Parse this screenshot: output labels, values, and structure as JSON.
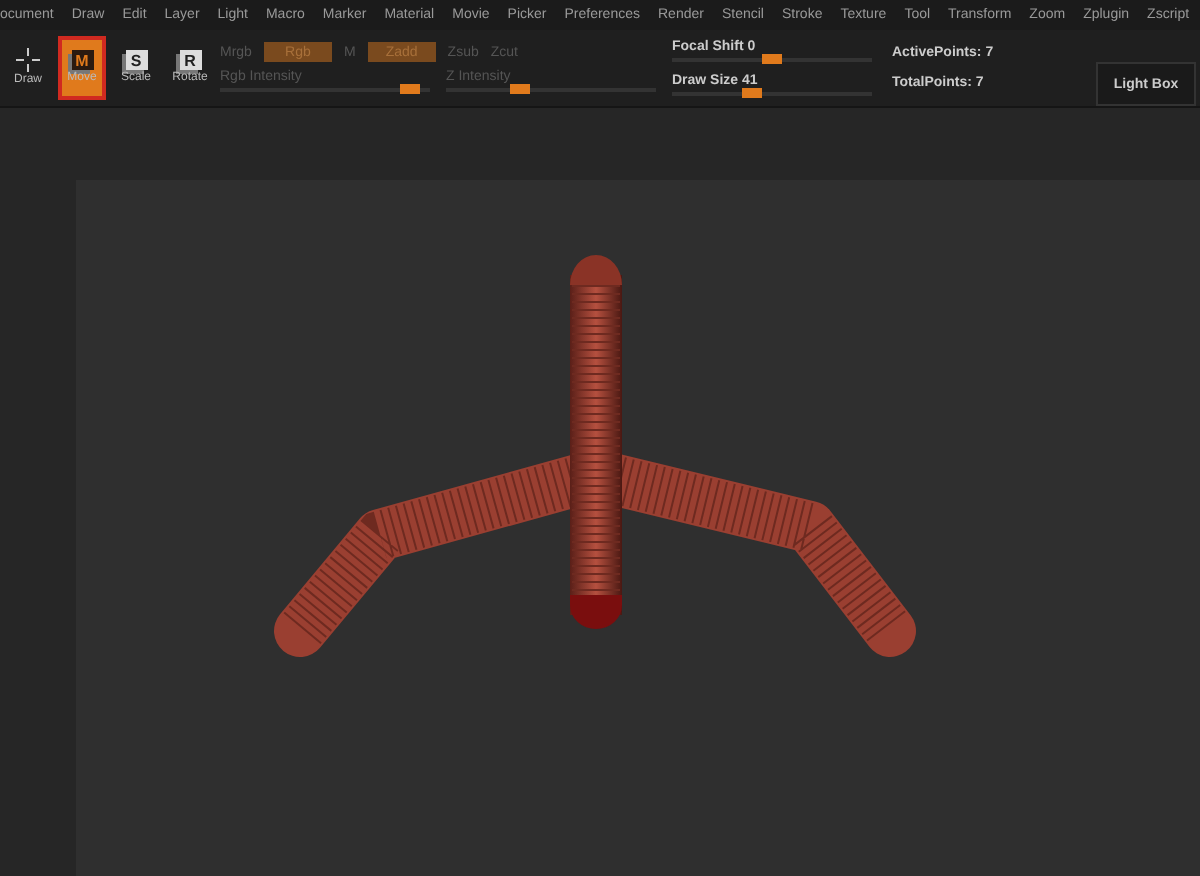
{
  "menu": [
    "ocument",
    "Draw",
    "Edit",
    "Layer",
    "Light",
    "Macro",
    "Marker",
    "Material",
    "Movie",
    "Picker",
    "Preferences",
    "Render",
    "Stencil",
    "Stroke",
    "Texture",
    "Tool",
    "Transform",
    "Zoom",
    "Zplugin",
    "Zscript"
  ],
  "tools": [
    {
      "label": "Draw",
      "kind": "cross",
      "selected": false
    },
    {
      "label": "Move",
      "glyph": "M",
      "kind": "letter",
      "selected": true
    },
    {
      "label": "Scale",
      "glyph": "S",
      "kind": "letter",
      "selected": false
    },
    {
      "label": "Rotate",
      "glyph": "R",
      "kind": "letter",
      "selected": false
    }
  ],
  "modes": [
    {
      "label": "Mrgb",
      "on": false,
      "kind": "text"
    },
    {
      "label": "Rgb",
      "on": true,
      "kind": "box"
    },
    {
      "label": "M",
      "on": false,
      "kind": "text"
    },
    {
      "label": "Zadd",
      "on": true,
      "kind": "box"
    },
    {
      "label": "Zsub",
      "on": false,
      "kind": "text"
    },
    {
      "label": "Zcut",
      "on": false,
      "kind": "text"
    }
  ],
  "intensity_sliders": [
    {
      "label": "Rgb Intensity",
      "level": 0.9
    },
    {
      "label": "Z Intensity",
      "level": 0.35
    }
  ],
  "sliders": [
    {
      "label": "Focal Shift",
      "value": "0",
      "level": 0.5
    },
    {
      "label": "Draw Size",
      "value": "41",
      "level": 0.4
    }
  ],
  "stats": [
    {
      "label": "ActivePoints:",
      "value": "7"
    },
    {
      "label": "TotalPoints:",
      "value": "7"
    }
  ],
  "light_box": "Light Box"
}
